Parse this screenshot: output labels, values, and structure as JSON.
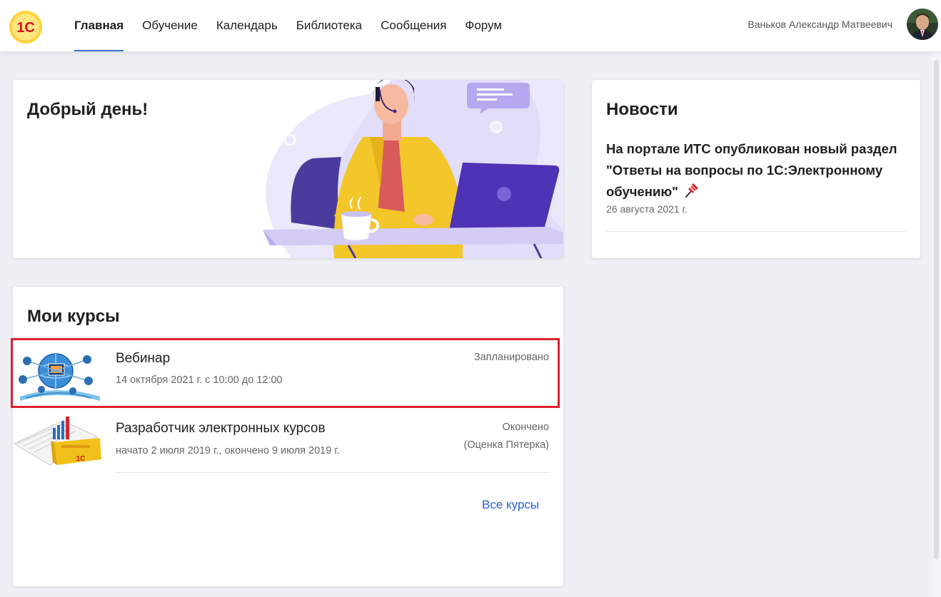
{
  "header": {
    "logo_text": "1С",
    "nav": [
      "Главная",
      "Обучение",
      "Календарь",
      "Библиотека",
      "Сообщения",
      "Форум"
    ],
    "active_nav": "Главная",
    "user_name": "Ваньков Александр Матвеевич"
  },
  "greeting": {
    "title": "Добрый день!"
  },
  "news": {
    "title": "Новости",
    "items": [
      {
        "title": "На портале ИТС опубликован новый раздел \"Ответы на вопросы по 1С:Электронному обучению\"",
        "pin_icon": "pushpin-icon",
        "date": "26 августа 2021 г."
      }
    ]
  },
  "courses": {
    "title": "Мои курсы",
    "items": [
      {
        "name": "Вебинар",
        "dates": "14 октября 2021 г. с 10:00 до 12:00",
        "status": "Запланировано",
        "grade": "",
        "thumb": "network-globe-thumbnail",
        "highlighted": true
      },
      {
        "name": "Разработчик электронных курсов",
        "dates": "начато 2 июля 2019 г., окончено 9 июля 2019 г.",
        "status": "Окончено",
        "grade": "(Оценка Пятерка)",
        "thumb": "1c-box-chart-thumbnail",
        "highlighted": false
      }
    ],
    "all_link": "Все курсы"
  },
  "colors": {
    "accent": "#3a6ed8",
    "link": "#2a5fd6",
    "highlight": "#e0202c",
    "background": "#eef0f5"
  }
}
